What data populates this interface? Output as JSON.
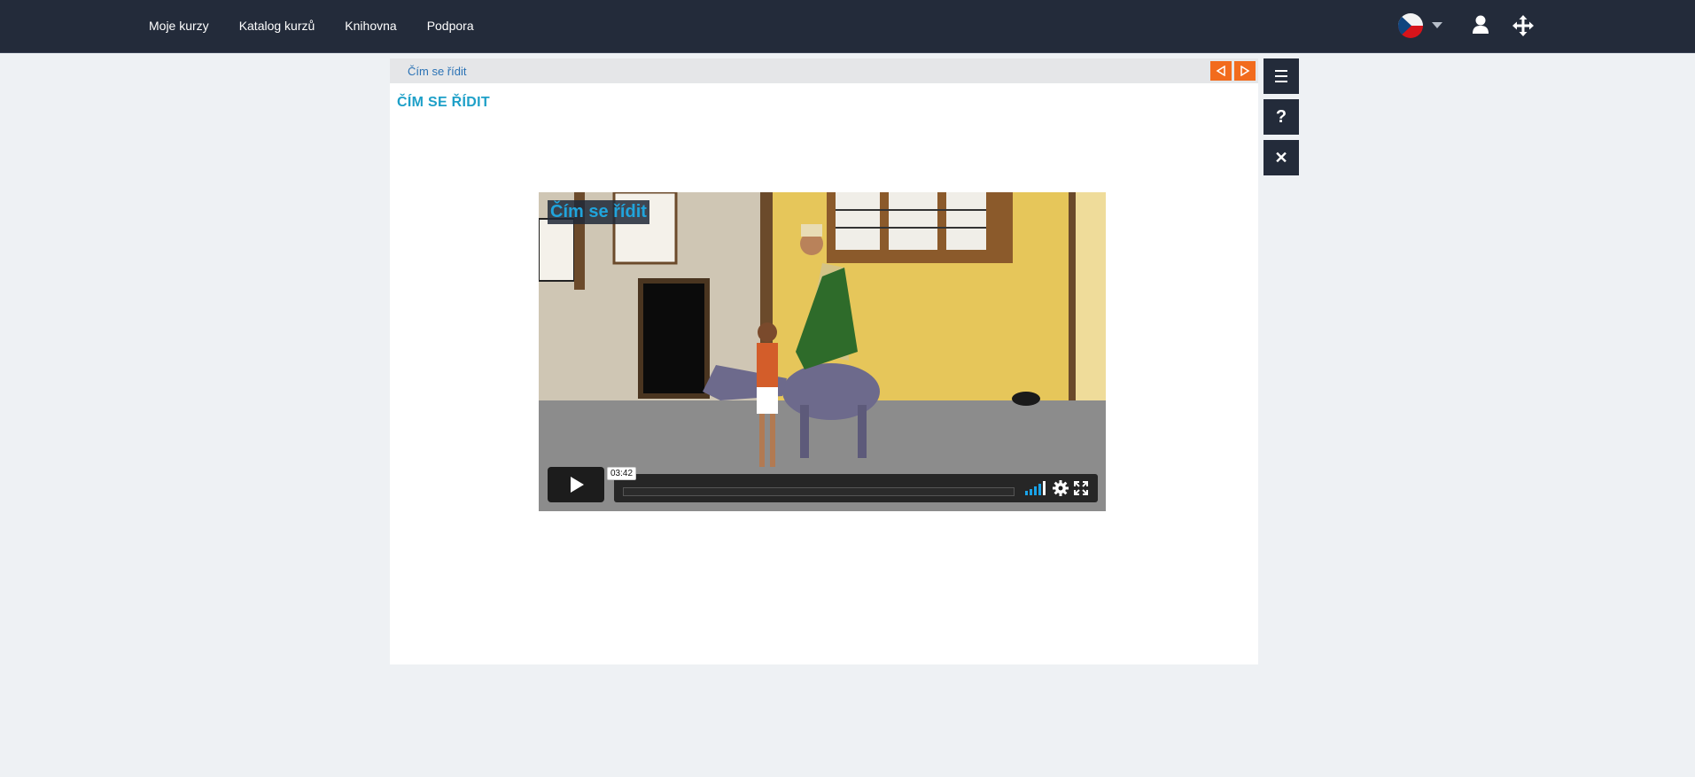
{
  "nav": {
    "items": [
      {
        "label": "Moje kurzy"
      },
      {
        "label": "Katalog kurzů"
      },
      {
        "label": "Knihovna"
      },
      {
        "label": "Podpora"
      }
    ],
    "language_flag": "czech-flag-icon",
    "icons": [
      "chevron-down-icon",
      "user-icon",
      "move-icon"
    ]
  },
  "breadcrumb": {
    "label": "Čím se řídit"
  },
  "page": {
    "title": "ČÍM SE ŘÍDIT"
  },
  "video": {
    "overlay_title": "Čím se řídit",
    "time_tooltip": "03:42",
    "progress": 0
  },
  "side_buttons": {
    "menu_icon": "menu-icon",
    "help_glyph": "?",
    "close_glyph": "✕"
  },
  "colors": {
    "topbar": "#232b3a",
    "accent_orange": "#f26b1d",
    "title_blue": "#1ea0c8",
    "link_blue": "#2a72b5"
  }
}
